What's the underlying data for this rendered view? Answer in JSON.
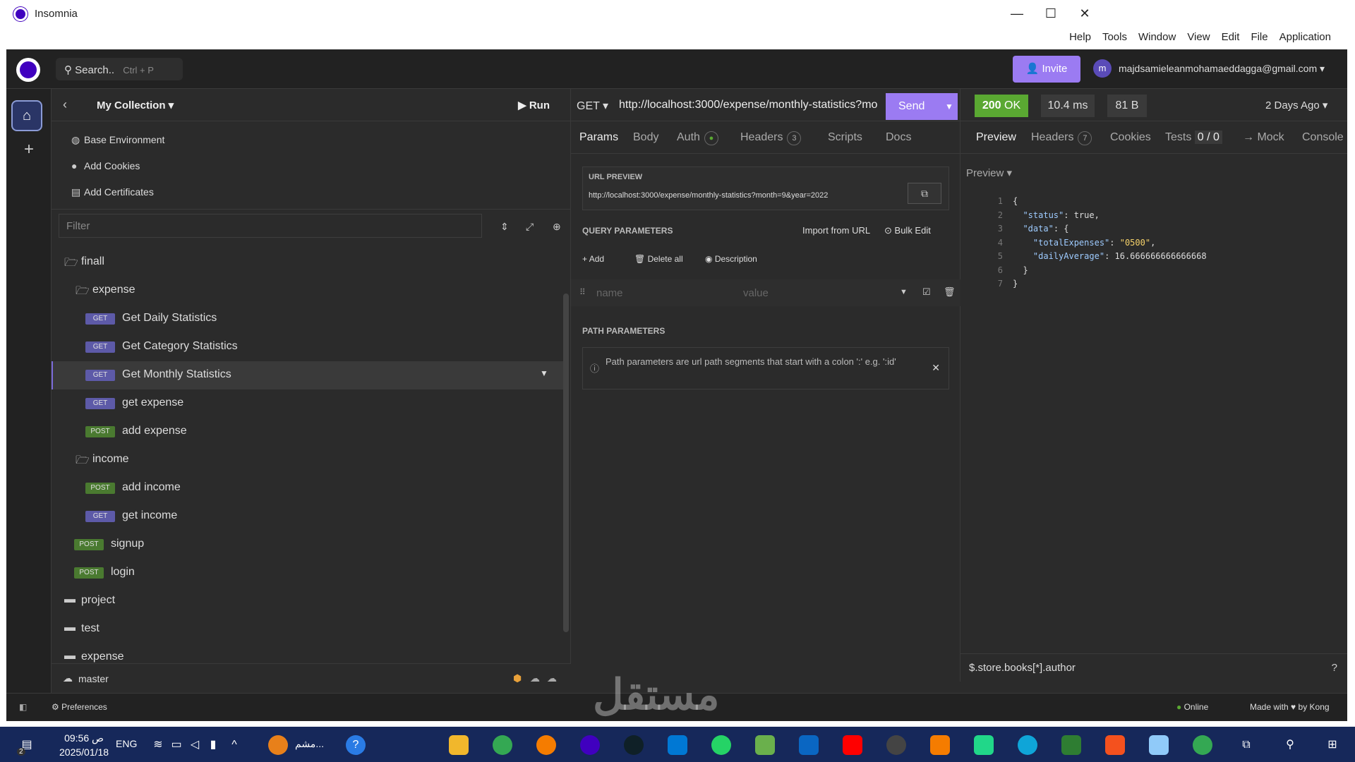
{
  "window": {
    "title": "Insomnia",
    "menu": [
      "Help",
      "Tools",
      "Window",
      "View",
      "Edit",
      "File",
      "Application"
    ],
    "controls": [
      "—",
      "☐",
      "✕"
    ]
  },
  "topbar": {
    "search_label": "Search..",
    "search_shortcut": "Ctrl + P",
    "invite_label": "Invite",
    "avatar_letter": "m",
    "email": "majdsamieleanmohamaeddagga@gmail.com"
  },
  "collection": {
    "title": "My Collection",
    "run_label": "Run"
  },
  "env_items": [
    {
      "label": "Base Environment",
      "icon": "globe-icon"
    },
    {
      "label": "Add Cookies",
      "icon": "cookie-icon"
    },
    {
      "label": "Add Certificates",
      "icon": "certificate-icon"
    }
  ],
  "filter_placeholder": "Filter",
  "tree": [
    {
      "type": "folder",
      "label": "finall",
      "indent": 0
    },
    {
      "type": "folder",
      "label": "expense",
      "indent": 1
    },
    {
      "type": "request",
      "method": "GET",
      "label": "Get Daily Statistics",
      "indent": 2
    },
    {
      "type": "request",
      "method": "GET",
      "label": "Get Category Statistics",
      "indent": 2
    },
    {
      "type": "request",
      "method": "GET",
      "label": "Get Monthly Statistics",
      "indent": 2,
      "selected": true
    },
    {
      "type": "request",
      "method": "GET",
      "label": "get expense",
      "indent": 2
    },
    {
      "type": "request",
      "method": "POST",
      "label": "add expense",
      "indent": 2
    },
    {
      "type": "folder",
      "label": "income",
      "indent": 1
    },
    {
      "type": "request",
      "method": "POST",
      "label": "add income",
      "indent": 2
    },
    {
      "type": "request",
      "method": "GET",
      "label": "get income",
      "indent": 2
    },
    {
      "type": "request",
      "method": "POST",
      "label": "signup",
      "indent": 1
    },
    {
      "type": "request",
      "method": "POST",
      "label": "login",
      "indent": 1
    },
    {
      "type": "folder-closed",
      "label": "project",
      "indent": 0
    },
    {
      "type": "folder-closed",
      "label": "test",
      "indent": 0
    },
    {
      "type": "folder-closed",
      "label": "expense",
      "indent": 0
    }
  ],
  "branch": "master",
  "preferences_label": "Preferences",
  "request": {
    "method": "GET",
    "url": "http://localhost:3000/expense/monthly-statistics?mo",
    "send_label": "Send",
    "tabs": [
      "Params",
      "Body",
      "Auth",
      "Headers",
      "Scripts",
      "Docs"
    ],
    "headers_count": "3",
    "url_preview_title": "URL PREVIEW",
    "url_preview": "http://localhost:3000/expense/monthly-statistics?month=9&year=2022",
    "query_title": "QUERY PARAMETERS",
    "import_label": "Import from URL",
    "bulk_label": "Bulk Edit",
    "add_label": "Add",
    "delete_label": "Delete all",
    "description_label": "Description",
    "name_placeholder": "name",
    "value_placeholder": "value",
    "path_title": "PATH PARAMETERS",
    "path_info": "Path parameters are url path segments that start with a colon ':' e.g. ':id'"
  },
  "response": {
    "status_code": "200",
    "status_text": "OK",
    "time": "10.4 ms",
    "size": "81 B",
    "age": "2 Days Ago",
    "tabs": [
      "Preview",
      "Headers",
      "Cookies",
      "Tests",
      "→ Mock",
      "Console"
    ],
    "headers_count": "7",
    "tests_count": "0 / 0",
    "preview_mode": "Preview",
    "lines": [
      "1",
      "2",
      "3",
      "4",
      "5",
      "6",
      "7"
    ],
    "filter_expr": "$.store.books[*].author"
  },
  "footer": {
    "online": "Online",
    "made_with": "Made with",
    "by": "by Kong"
  },
  "taskbar": {
    "time": "09:56 ص",
    "date": "2025/01/18",
    "lang": "ENG",
    "notif": "2",
    "app_text": "مشم..."
  },
  "watermark": "مستقل"
}
